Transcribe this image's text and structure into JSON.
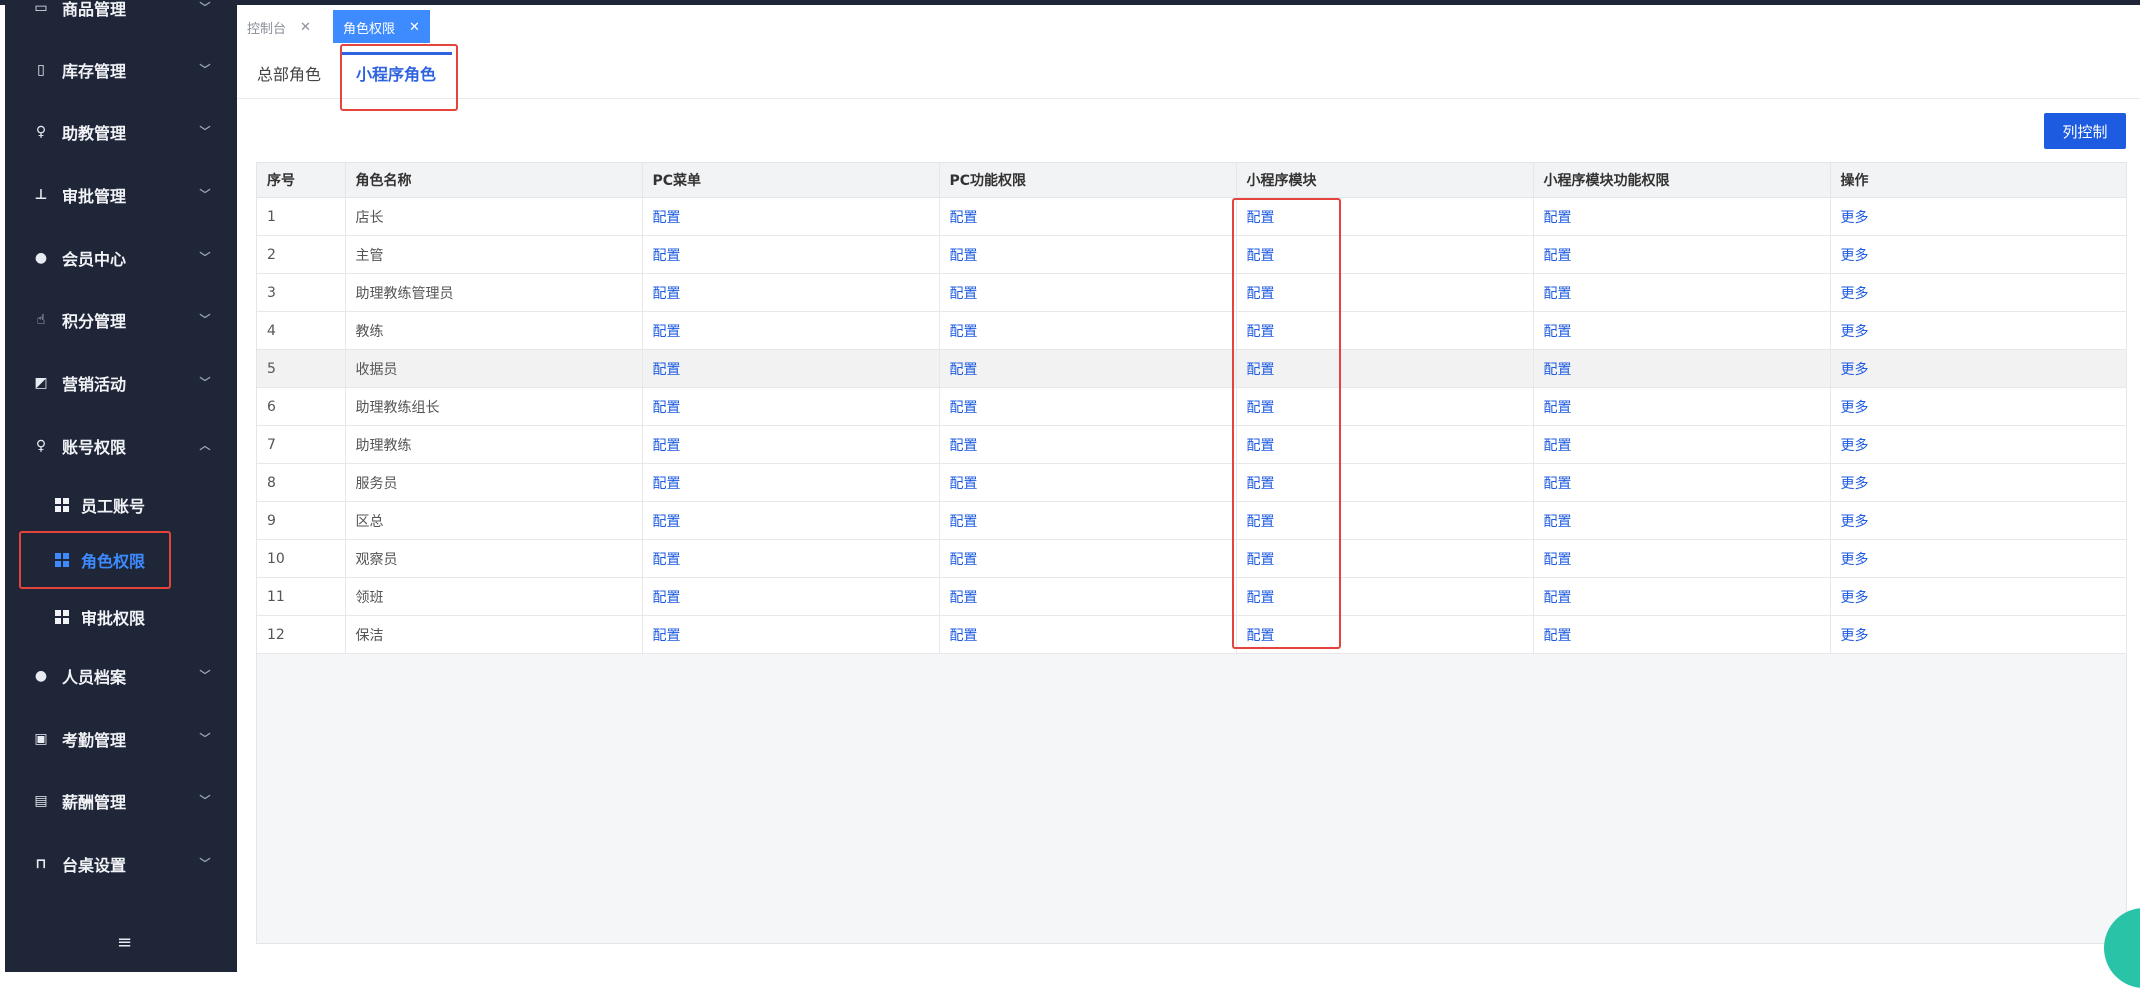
{
  "sidebar": {
    "items": [
      {
        "label": "商品管理",
        "icon": "box-icon"
      },
      {
        "label": "库存管理",
        "icon": "inventory-icon"
      },
      {
        "label": "助教管理",
        "icon": "user-icon"
      },
      {
        "label": "审批管理",
        "icon": "stamp-icon"
      },
      {
        "label": "会员中心",
        "icon": "member-icon"
      },
      {
        "label": "积分管理",
        "icon": "hand-icon"
      },
      {
        "label": "营销活动",
        "icon": "chart-icon"
      },
      {
        "label": "账号权限",
        "icon": "account-icon"
      },
      {
        "label": "人员档案",
        "icon": "person-icon"
      },
      {
        "label": "考勤管理",
        "icon": "clipboard-icon"
      },
      {
        "label": "薪酬管理",
        "icon": "salary-icon"
      },
      {
        "label": "台桌设置",
        "icon": "table-icon"
      }
    ],
    "subitems": [
      {
        "label": "员工账号"
      },
      {
        "label": "角色权限"
      },
      {
        "label": "审批权限"
      }
    ]
  },
  "tabs": [
    {
      "label": "控制台"
    },
    {
      "label": "角色权限"
    }
  ],
  "subtabs": [
    {
      "label": "总部角色"
    },
    {
      "label": "小程序角色"
    }
  ],
  "toolbar": {
    "column_control": "列控制"
  },
  "table": {
    "headers": [
      "序号",
      "角色名称",
      "PC菜单",
      "PC功能权限",
      "小程序模块",
      "小程序模块功能权限",
      "操作"
    ],
    "link_config": "配置",
    "link_more": "更多",
    "rows": [
      {
        "index": "1",
        "name": "店长"
      },
      {
        "index": "2",
        "name": "主管"
      },
      {
        "index": "3",
        "name": "助理教练管理员"
      },
      {
        "index": "4",
        "name": "教练"
      },
      {
        "index": "5",
        "name": "收据员"
      },
      {
        "index": "6",
        "name": "助理教练组长"
      },
      {
        "index": "7",
        "name": "助理教练"
      },
      {
        "index": "8",
        "name": "服务员"
      },
      {
        "index": "9",
        "name": "区总"
      },
      {
        "index": "10",
        "name": "观察员"
      },
      {
        "index": "11",
        "name": "领班"
      },
      {
        "index": "12",
        "name": "保洁"
      }
    ]
  }
}
